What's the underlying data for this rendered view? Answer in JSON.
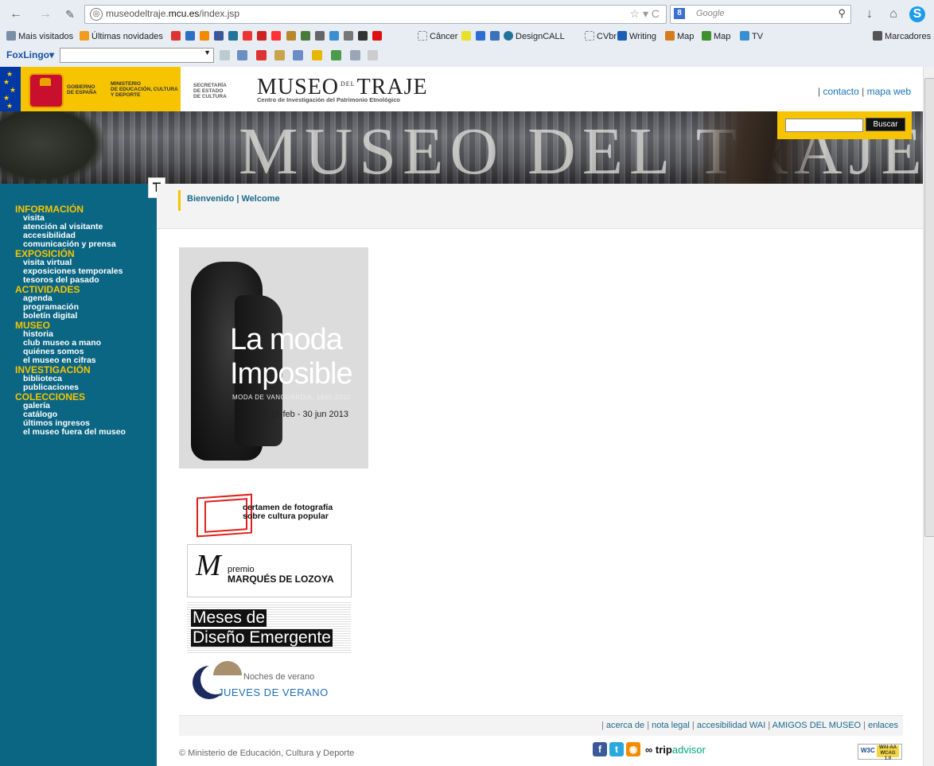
{
  "browser": {
    "url_prefix": "museodeltraje.",
    "url_domain": "mcu.es",
    "url_path": "/index.jsp",
    "search_engine": "Google",
    "bookmarks": [
      "Mais visitados",
      "Últimas novidades",
      "Câncer",
      "DesignCALL",
      "CVbr",
      "Writing",
      "Map",
      "Map",
      "TV"
    ],
    "bookmark_folder": "Marcadores",
    "toolbar_label": "FoxLingo"
  },
  "site": {
    "gov_lines": [
      "GOBIERNO",
      "DE ESPAÑA"
    ],
    "ministry_lines": [
      "MINISTERIO",
      "DE EDUCACIÓN, CULTURA",
      "Y DEPORTE"
    ],
    "secretaria_lines": [
      "SECRETARÍA",
      "DE ESTADO",
      "DE CULTURA"
    ],
    "logo_a": "MUSEO",
    "logo_small": "DEL",
    "logo_b": "TRAJE",
    "logo_sub": "Centro de Investigación del Patrimonio Etnológico",
    "header_links": [
      "contacto",
      "mapa web"
    ],
    "banner_word": "MUSEO DEL TRAJE",
    "search_button": "Buscar"
  },
  "sidebar": {
    "tab_letter": "T",
    "sections": [
      {
        "title": "INFORMACIÓN",
        "items": [
          "visita",
          "atención al visitante",
          "accesibilidad",
          "comunicación y prensa"
        ]
      },
      {
        "title": "EXPOSICIÓN",
        "items": [
          "visita virtual",
          "exposiciones temporales",
          "tesoros del pasado"
        ]
      },
      {
        "title": "ACTIVIDADES",
        "items": [
          "agenda",
          "programación",
          "boletín digital"
        ]
      },
      {
        "title": "MUSEO",
        "items": [
          "historia",
          "club museo a mano",
          "quiénes somos",
          "el museo en cifras"
        ]
      },
      {
        "title": "INVESTIGACIÓN",
        "items": [
          "biblioteca",
          "publicaciones"
        ]
      },
      {
        "title": "COLECCIONES",
        "items": [
          "galería",
          "catálogo",
          "últimos ingresos",
          "el museo fuera del museo"
        ]
      }
    ]
  },
  "welcome": {
    "es": "Bienvenido",
    "en": "Welcome"
  },
  "poster": {
    "line1": "La moda",
    "line2": "Imposible",
    "subtitle": "MODA DE VANGUARDIA, 1960-2010",
    "dates": "// 27 feb - 30 jun 2013"
  },
  "promos": {
    "foto_l1": "certamen de fotografía",
    "foto_l2": "sobre cultura popular",
    "lozoya_mark": "M",
    "lozoya_l1": "premio",
    "lozoya_l2": "MARQUÉS DE LOZOYA",
    "meses_l1": "Meses de",
    "meses_l2": "Diseño Emergente",
    "noches_l1": "Noches de verano",
    "noches_l2": "JUEVES DE VERANO"
  },
  "footer": {
    "links": [
      "acerca de",
      "nota legal",
      "accesibilidad WAI",
      "AMIGOS DEL MUSEO",
      "enlaces"
    ],
    "copyright": "© Ministerio de Educación, Cultura y Deporte",
    "tripadvisor_a": "trip",
    "tripadvisor_b": "advisor",
    "wai_w3": "W3C",
    "wai_level": "WAI-AA WCAG 1.0"
  },
  "colors": {
    "sidebar_bg": "#0b6684",
    "accent_yellow": "#f6c400",
    "link_blue": "#1b6a8a"
  }
}
